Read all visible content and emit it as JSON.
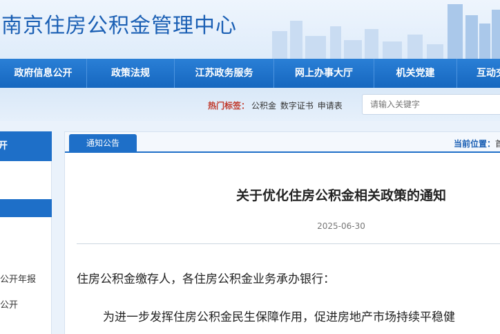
{
  "header": {
    "site_title": "南京住房公积金管理中心"
  },
  "nav": {
    "items": [
      {
        "label": "政府信息公开"
      },
      {
        "label": "政策法规"
      },
      {
        "label": "江苏政务服务"
      },
      {
        "label": "网上办事大厅"
      },
      {
        "label": "机关党建"
      },
      {
        "label": "互动交"
      }
    ]
  },
  "search": {
    "hot_label": "热门标签：",
    "tags": [
      "公积金",
      "数字证书",
      "申请表"
    ],
    "placeholder": "请输入关键字"
  },
  "sidebar": {
    "heading": "开",
    "items": [
      {
        "label": "公开年报"
      },
      {
        "label": "公开"
      }
    ]
  },
  "content": {
    "tab_label": "通知公告",
    "location_label": "当前位置：",
    "location_crumb": "首",
    "title": "关于优化住房公积金相关政策的通知",
    "date": "2025-06-30",
    "salutation": "住房公积金缴存人，各住房公积金业务承办银行：",
    "body_line1": "为进一步发挥住房公积金民生保障作用，促进房地产市场持续平稳健"
  },
  "colors": {
    "primary_blue": "#1e6fc8",
    "title_blue": "#1a5fb4",
    "hot_label_red": "#c0392b"
  }
}
